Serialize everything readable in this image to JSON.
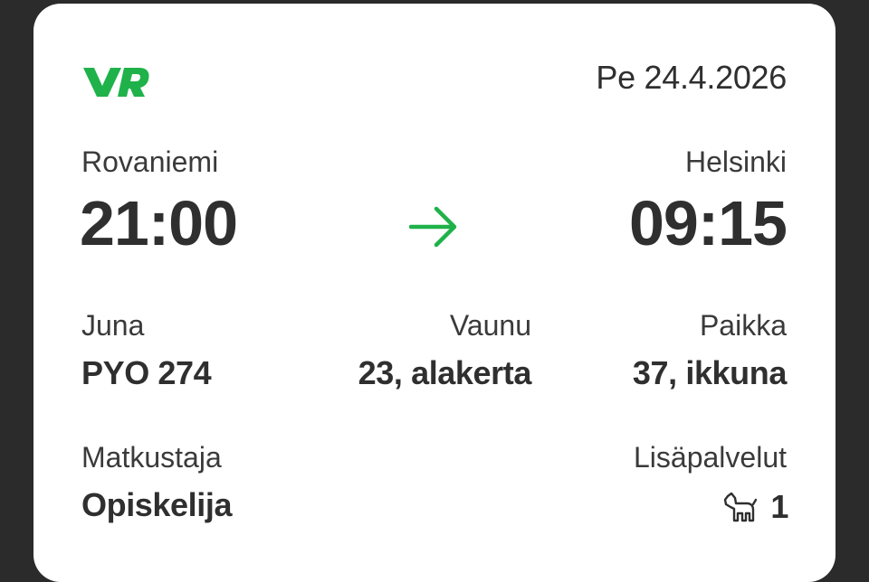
{
  "header": {
    "logo_text": "VR",
    "date": "Pe 24.4.2026"
  },
  "route": {
    "from_city": "Rovaniemi",
    "departure_time": "21:00",
    "to_city": "Helsinki",
    "arrival_time": "09:15"
  },
  "details": {
    "train_label": "Juna",
    "train_value": "PYO 274",
    "car_label": "Vaunu",
    "car_value": "23, alakerta",
    "seat_label": "Paikka",
    "seat_value": "37, ikkuna"
  },
  "passenger": {
    "label": "Matkustaja",
    "value": "Opiskelija"
  },
  "extras": {
    "label": "Lisäpalvelut",
    "icon": "dog-icon",
    "count": "1"
  },
  "colors": {
    "accent_green": "#1fb24a",
    "text": "#2f2f2f",
    "background": "#2b2b2b",
    "card": "#ffffff"
  }
}
